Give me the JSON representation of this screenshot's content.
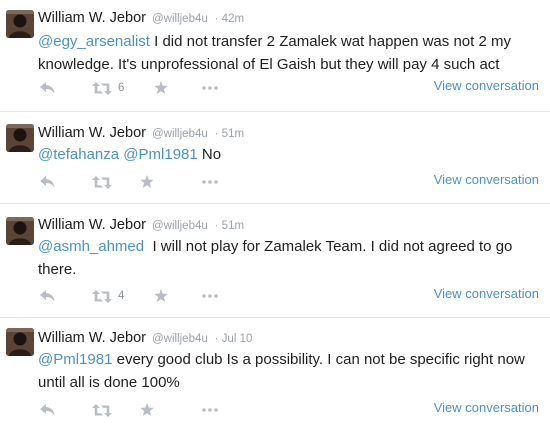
{
  "tweets": [
    {
      "name": "William W. Jebor",
      "handle": "@willjeb4u",
      "time": "· 42m",
      "mention1": "@egy_arsenalist",
      "mention2": "",
      "text": " I did not transfer 2 Zamalek wat happen was not 2 my knowledge. It's unprofessional of El Gaish but they will pay 4 such act",
      "retweets": "6",
      "view": "View conversation"
    },
    {
      "name": "William W. Jebor",
      "handle": "@willjeb4u",
      "time": "· 51m",
      "mention1": "@tefahanza",
      "mention2": "@Pml1981",
      "text": " No",
      "retweets": "",
      "view": "View conversation"
    },
    {
      "name": "William W. Jebor",
      "handle": "@willjeb4u",
      "time": "· 51m",
      "mention1": "@asmh_ahmed",
      "mention2": "",
      "text": "  I will not play for Zamalek Team. I did not agreed to go there.",
      "retweets": "4",
      "view": "View conversation"
    },
    {
      "name": "William W. Jebor",
      "handle": "@willjeb4u",
      "time": "· Jul 10",
      "mention1": "@Pml1981",
      "mention2": "",
      "text": " every good club Is a possibility. I can not be specific right now until all is done 100%",
      "retweets": "",
      "view": "View conversation"
    }
  ],
  "icons": {
    "reply": "reply-icon",
    "retweet": "retweet-icon",
    "favorite": "star-icon",
    "more": "more-icon"
  },
  "colors": {
    "link": "#4a91c9",
    "icon": "#b8bec3",
    "divider": "#e1e8ed"
  }
}
